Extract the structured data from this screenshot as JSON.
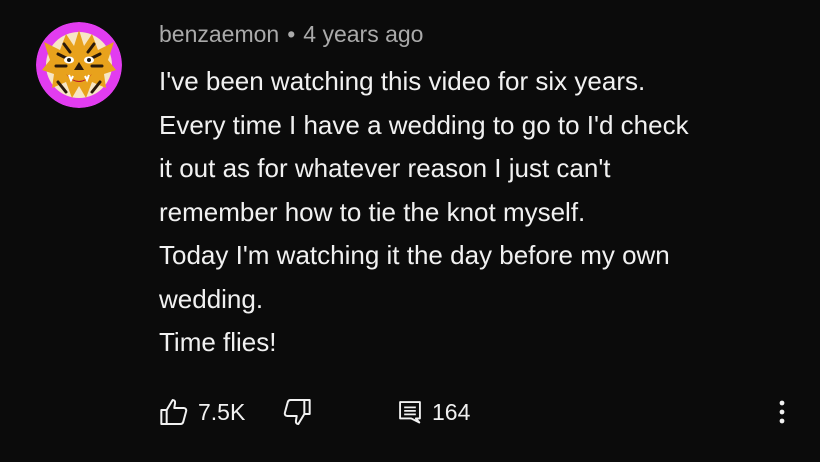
{
  "comment": {
    "author": "benzaemon",
    "separator": "•",
    "timestamp": "4 years ago",
    "avatar_icon": "tiger-face-avatar",
    "lines": [
      "I've been watching this video for six years.",
      "Every time I have a wedding to go to I'd check",
      "it out as for whatever reason I just can't",
      "remember how to tie the knot myself.",
      "Today I'm watching it the day before my own",
      "wedding.",
      "Time flies!"
    ]
  },
  "actions": {
    "like_icon": "thumbs-up-icon",
    "like_count": "7.5K",
    "dislike_icon": "thumbs-down-icon",
    "reply_icon": "comment-icon",
    "reply_count": "164",
    "more_icon": "more-vertical-icon"
  },
  "colors": {
    "background": "#0b0b0b",
    "text": "#f1f1f1",
    "meta_text": "#aaaaaa",
    "avatar_ring": "#e23cf0",
    "avatar_tiger": "#e8a21c"
  }
}
